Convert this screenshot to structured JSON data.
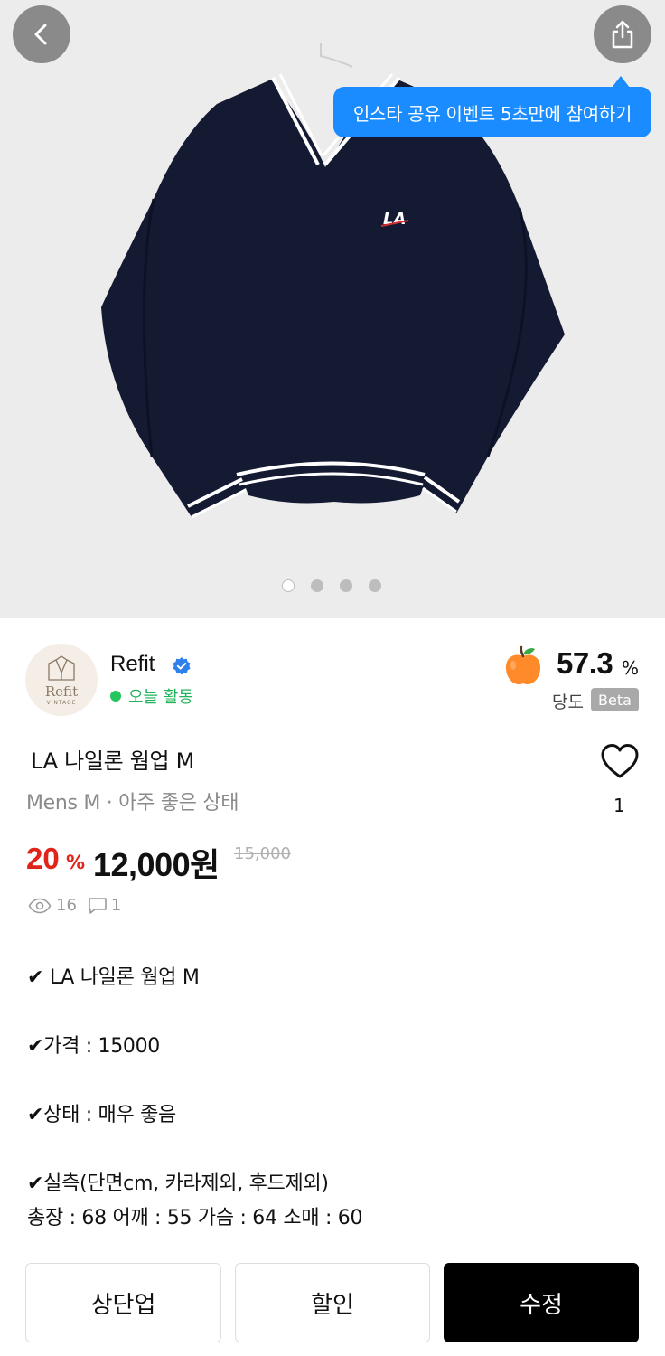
{
  "hero": {
    "tooltip": "인스타 공유 이벤트 5초만에 참여하기",
    "image_logo_text": "LA",
    "page_dots": 4,
    "active_dot": 0
  },
  "seller": {
    "name": "Refit",
    "status": "오늘 활동",
    "avatar_logo": "Refit",
    "avatar_sub": "VINTAGE"
  },
  "sweetness": {
    "value": "57.3",
    "unit": "%",
    "label": "당도",
    "badge": "Beta"
  },
  "product": {
    "title": "LA 나일론 웜업 M",
    "subtitle": "Mens M · 아주 좋은 상태",
    "likes": "1",
    "discount": "20",
    "discount_unit": "%",
    "price": "12,000원",
    "original_price": "15,000",
    "views": "16",
    "chats": "1"
  },
  "description": {
    "line1": "✔ LA 나일론 웜업 M",
    "line2": "✔가격 : 15000",
    "line3": "✔상태 : 매우 좋음",
    "line4": "✔실측(단면cm, 카라제외, 후드제외)",
    "line5": "총장 : 68 어깨 : 55 가슴 : 64 소매 : 60"
  },
  "actions": {
    "bump": "상단업",
    "discount": "할인",
    "edit": "수정"
  },
  "colors": {
    "accent_blue": "#1a8cff",
    "discount_red": "#e2231a",
    "active_green": "#22c55e"
  },
  "icons": [
    "back-arrow-icon",
    "share-icon",
    "verified-badge-icon",
    "apple-icon",
    "heart-icon",
    "eye-icon",
    "chat-icon"
  ]
}
